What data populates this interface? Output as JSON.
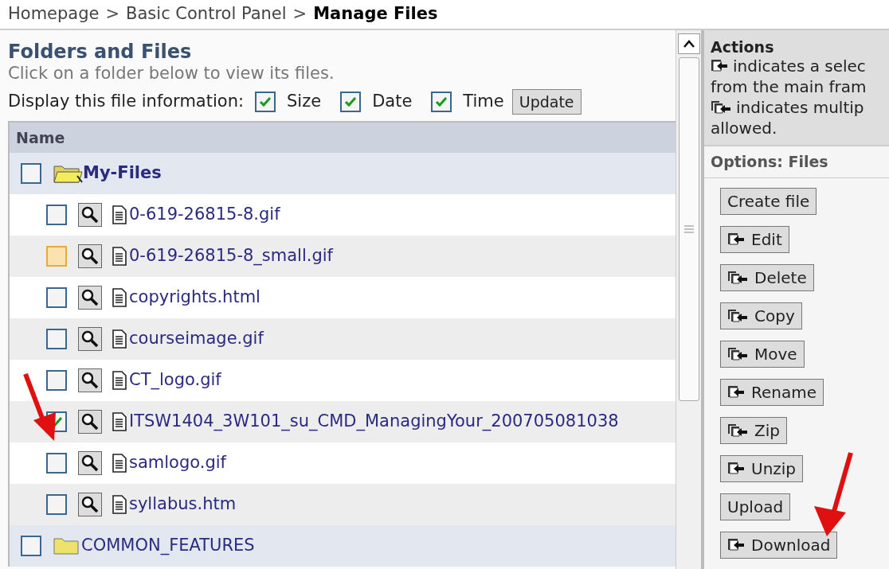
{
  "breadcrumb": [
    {
      "label": "Homepage",
      "current": false
    },
    {
      "label": "Basic Control Panel",
      "current": false
    },
    {
      "label": "Manage Files",
      "current": true
    }
  ],
  "breadcrumb_separator": ">",
  "heading": "Folders and Files",
  "subheading": "Click on a folder below to view its files.",
  "display_options": {
    "label": "Display this file information:",
    "options": [
      {
        "label": "Size",
        "checked": true
      },
      {
        "label": "Date",
        "checked": true
      },
      {
        "label": "Time",
        "checked": true
      }
    ],
    "button": "Update"
  },
  "table": {
    "column": "Name",
    "rows": [
      {
        "kind": "open_folder",
        "name": "My-Files",
        "checked": false,
        "highlighted": false
      },
      {
        "kind": "file",
        "name": "0-619-26815-8.gif",
        "checked": false,
        "highlighted": false
      },
      {
        "kind": "file",
        "name": "0-619-26815-8_small.gif",
        "checked": false,
        "highlighted": true
      },
      {
        "kind": "file",
        "name": "copyrights.html",
        "checked": false,
        "highlighted": false
      },
      {
        "kind": "file",
        "name": "courseimage.gif",
        "checked": false,
        "highlighted": false
      },
      {
        "kind": "file",
        "name": "CT_logo.gif",
        "checked": false,
        "highlighted": false
      },
      {
        "kind": "file",
        "name": "ITSW1404_3W101_su_CMD_ManagingYour_200705081038",
        "checked": true,
        "highlighted": false
      },
      {
        "kind": "file",
        "name": "samlogo.gif",
        "checked": false,
        "highlighted": false
      },
      {
        "kind": "file",
        "name": "syllabus.htm",
        "checked": false,
        "highlighted": false
      },
      {
        "kind": "folder",
        "name": "COMMON_FEATURES",
        "checked": false,
        "highlighted": false
      }
    ]
  },
  "actions": {
    "title": "Actions",
    "legend": [
      {
        "kind": "single",
        "text": "indicates a selec"
      },
      {
        "kind": "plain",
        "text": "from the main fram"
      },
      {
        "kind": "multiple",
        "text": "indicates multip"
      },
      {
        "kind": "plain",
        "text": "allowed."
      }
    ]
  },
  "options": {
    "title": "Options: Files",
    "buttons": [
      {
        "kind": "plain",
        "label": "Create file"
      },
      {
        "kind": "single",
        "label": "Edit"
      },
      {
        "kind": "multiple",
        "label": "Delete"
      },
      {
        "kind": "multiple",
        "label": "Copy"
      },
      {
        "kind": "multiple",
        "label": "Move"
      },
      {
        "kind": "single",
        "label": "Rename"
      },
      {
        "kind": "multiple",
        "label": "Zip"
      },
      {
        "kind": "single",
        "label": "Unzip"
      },
      {
        "kind": "plain",
        "label": "Upload"
      },
      {
        "kind": "single",
        "label": "Download"
      }
    ]
  }
}
